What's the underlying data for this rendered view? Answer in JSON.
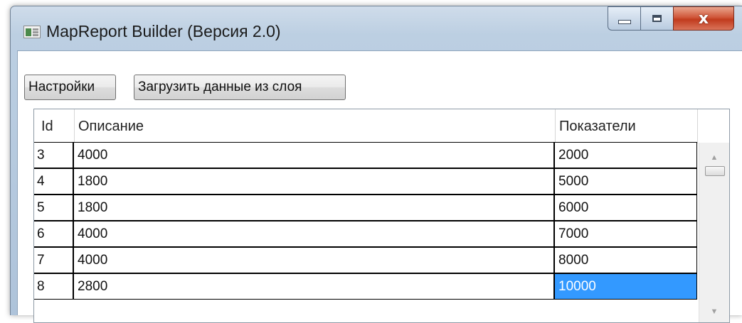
{
  "window": {
    "title": "MapReport Builder (Версия 2.0)",
    "controls": {
      "minimize_icon": "minimize-icon",
      "maximize_icon": "maximize-icon",
      "close_symbol": "x"
    }
  },
  "toolbar": {
    "settings_label": "Настройки",
    "load_label": "Загрузить данные из слоя"
  },
  "grid": {
    "columns": [
      {
        "key": "id",
        "label": "Id"
      },
      {
        "key": "desc",
        "label": "Описание"
      },
      {
        "key": "val",
        "label": "Показатели"
      }
    ],
    "rows": [
      {
        "id": "3",
        "desc": "4000",
        "val": "2000"
      },
      {
        "id": "4",
        "desc": "1800",
        "val": "5000"
      },
      {
        "id": "5",
        "desc": "1800",
        "val": "6000"
      },
      {
        "id": "6",
        "desc": "4000",
        "val": "7000"
      },
      {
        "id": "7",
        "desc": "4000",
        "val": "8000"
      },
      {
        "id": "8",
        "desc": "2800",
        "val": "10000",
        "selected": "val"
      }
    ],
    "selection_color": "#3399ff",
    "scroll_up_icon": "scroll-up-arrow-icon",
    "scroll_down_icon": "scroll-down-arrow-icon"
  }
}
